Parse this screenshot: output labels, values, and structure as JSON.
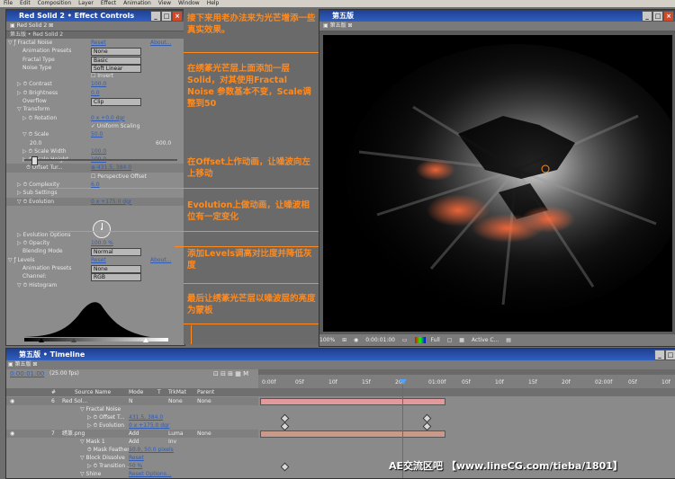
{
  "menubar": [
    "File",
    "Edit",
    "Composition",
    "Layer",
    "Effect",
    "Animation",
    "View",
    "Window",
    "Help"
  ],
  "effect_controls": {
    "title": "Red Solid 2 • Effect Controls",
    "tab": "Red Solid 2",
    "breadcrumb": "第五版 • Red Solid 2",
    "rows": [
      {
        "label": "▽ ƒ Fractal Noise",
        "indent": 2,
        "reset": "Reset",
        "about": "About..."
      },
      {
        "label": "Animation Presets",
        "indent": 18,
        "dropdown": "None"
      },
      {
        "label": "Fractal Type",
        "indent": 18,
        "dropdown": "Basic"
      },
      {
        "label": "Noise Type",
        "indent": 18,
        "dropdown": "Soft Linear"
      },
      {
        "label": "",
        "indent": 18,
        "plain": "☐ Invert"
      },
      {
        "label": "▷ ⏱ Contrast",
        "indent": 12,
        "value": "100.0"
      },
      {
        "label": "▷ ⏱ Brightness",
        "indent": 12,
        "value": "0.0"
      },
      {
        "label": "Overflow",
        "indent": 18,
        "dropdown": "Clip"
      },
      {
        "label": "▽ Transform",
        "indent": 12
      },
      {
        "label": "▷ ⏱ Rotation",
        "indent": 18,
        "value": "0 x +0.0 dgr"
      },
      {
        "label": "",
        "indent": 18,
        "plain": "✓ Uniform Scaling"
      },
      {
        "label": "▽ ⏱ Scale",
        "indent": 18,
        "value": "50.0"
      },
      {
        "label": "20.0",
        "indent": 26,
        "plain": "600.0"
      },
      {
        "label": "▷ ⏱ Scale Width",
        "indent": 18,
        "value": "100.0"
      },
      {
        "label": "▷ ⏱ Scale Height",
        "indent": 18,
        "value": "100.0"
      },
      {
        "label": "⏱ Offset Tur...",
        "indent": 22,
        "value": "⊕ 431.5, 384.0"
      },
      {
        "label": "",
        "indent": 18,
        "plain": "☐ Perspective Offset"
      },
      {
        "label": "▷ ⏱ Complexity",
        "indent": 12,
        "value": "6.0"
      },
      {
        "label": "▷ Sub Settings",
        "indent": 12
      },
      {
        "label": "▽ ⏱ Evolution",
        "indent": 12,
        "value": "0 x +175.0 dgr"
      },
      {
        "label": "",
        "indent": 12
      },
      {
        "label": "",
        "indent": 12
      },
      {
        "label": "",
        "indent": 12
      },
      {
        "label": "▷ Evolution Options",
        "indent": 12
      },
      {
        "label": "▷ ⏱ Opacity",
        "indent": 12,
        "value": "100.0 %"
      },
      {
        "label": "Blending Mode",
        "indent": 18,
        "dropdown": "Normal"
      },
      {
        "label": "▽ ƒ Levels",
        "indent": 2,
        "reset": "Reset",
        "about": "About..."
      },
      {
        "label": "Animation Presets",
        "indent": 18,
        "dropdown": "None"
      },
      {
        "label": "Channel:",
        "indent": 18,
        "dropdown": "RGB"
      },
      {
        "label": "▽ ⏱ Histogram",
        "indent": 12
      }
    ]
  },
  "notes": [
    "接下来用老办法来为光芒增添一些真实效果。",
    "在绣篆光芒层上面添加一层Solid，对其使用Fractal Noise 参数基本不变，Scale调整到50",
    "在Offset上作动画，让噪波向左上移动",
    "Evolution上做动画，让噪波相位有一定变化",
    "添加Levels调高对比度并降低灰度",
    "最后让绣篆光芒层以噪波层的亮度为蒙板"
  ],
  "comp": {
    "title": "第五版",
    "tab": "第五版",
    "zoom": "100%",
    "timecode": "0:00:01:00",
    "resolution": "Full",
    "camera": "Active C..."
  },
  "timeline": {
    "title": "第五版 • Timeline",
    "tab": "第五版",
    "timecode": "0:00:01:00",
    "fps": "(25.00 fps)",
    "columns": [
      "#",
      "Source Name",
      "Mode",
      "T",
      "TrkMat",
      "Parent"
    ],
    "ruler": [
      "0:00f",
      "05f",
      "10f",
      "15f",
      "20f",
      "01:00f",
      "05f",
      "10f",
      "15f",
      "20f",
      "02:00f",
      "05f",
      "10f"
    ],
    "rows": [
      {
        "num": "6",
        "name": "Red Sol...",
        "mode": "N",
        "trk": "None",
        "parent": "None",
        "indent": 0
      },
      {
        "name": "▽ Fractal Noise",
        "indent": 20
      },
      {
        "name": "▷ ⏱ Offset T...",
        "value": "431.5, 384.0",
        "indent": 28
      },
      {
        "name": "▷ ⏱ Evolution",
        "value": "0 x +175.0 dgr",
        "indent": 28
      },
      {
        "num": "7",
        "name": "绣篆.png",
        "mode": "Add",
        "trk": "Luma",
        "parent": "None",
        "indent": 0
      },
      {
        "name": "▽ Mask 1",
        "mode": "Add",
        "trk": "Inv",
        "indent": 20
      },
      {
        "name": "⏱ Mask Feather",
        "value": "50.0, 50.0 pixels",
        "indent": 28
      },
      {
        "name": "▽ Block Dissolve",
        "value": "Reset",
        "indent": 20
      },
      {
        "name": "▷ ⏱ Transition ...",
        "value": "50 %",
        "indent": 28
      },
      {
        "name": "▽ Shine",
        "value": "Reset Options...",
        "indent": 20
      }
    ]
  },
  "watermark": "AE交流区吧  【www.lineCG.com/tieba/1801】"
}
